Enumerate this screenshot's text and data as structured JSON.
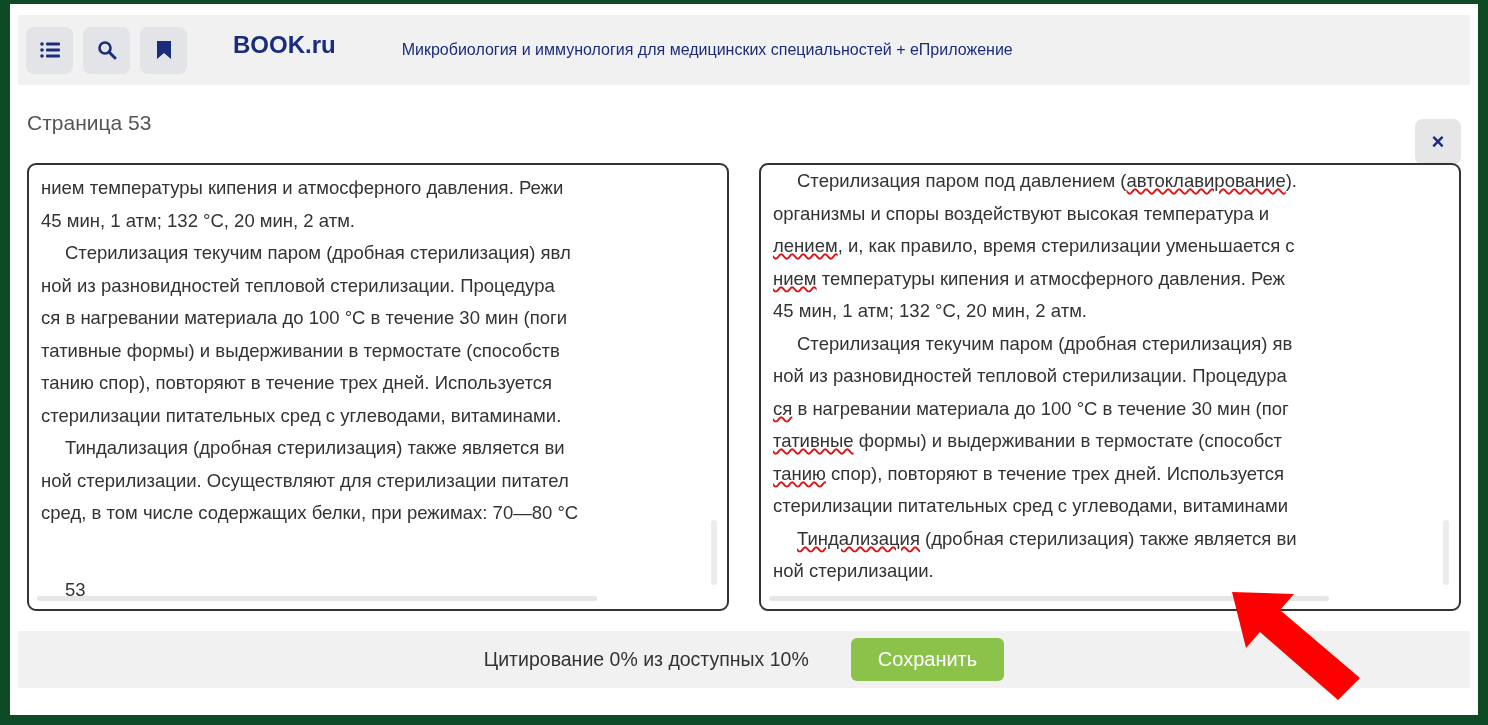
{
  "toolbar": {
    "buttons": [
      {
        "kind": "contents"
      },
      {
        "kind": "search"
      },
      {
        "kind": "bookmark"
      }
    ],
    "logo": "BOOK.ru",
    "book_title": "Микробиология и иммунология для медицинских специальностей + еПриложение"
  },
  "page_label": "Страница 53",
  "close_label": "×",
  "panels": [
    {
      "lines": [
        {
          "indent": false,
          "segments": [
            {
              "text": "нием температуры кипения и атмосферного давления. Режи",
              "misspelled": false
            }
          ]
        },
        {
          "indent": false,
          "segments": [
            {
              "text": "45 мин, 1 атм; 132 °C, 20 мин, 2 атм.",
              "misspelled": false
            }
          ]
        },
        {
          "indent": true,
          "segments": [
            {
              "text": "Стерилизация текучим паром (дробная стерилизация) явл",
              "misspelled": false
            }
          ]
        },
        {
          "indent": false,
          "segments": [
            {
              "text": "ной из разновидностей тепловой стерилизации. Процедура",
              "misspelled": false
            }
          ]
        },
        {
          "indent": false,
          "segments": [
            {
              "text": "ся в нагревании материала до 100 °C в течение 30 мин (поги",
              "misspelled": false
            }
          ]
        },
        {
          "indent": false,
          "segments": [
            {
              "text": "тативные формы) и выдерживании в термостате (способств",
              "misspelled": false
            }
          ]
        },
        {
          "indent": false,
          "segments": [
            {
              "text": "танию спор), повторяют в течение трех дней. Используется",
              "misspelled": false
            }
          ]
        },
        {
          "indent": false,
          "segments": [
            {
              "text": "стерилизации питательных сред с углеводами, витаминами.",
              "misspelled": false
            }
          ]
        },
        {
          "indent": true,
          "segments": [
            {
              "text": "Тиндализация (дробная стерилизация) также является ви",
              "misspelled": false
            }
          ]
        },
        {
          "indent": false,
          "segments": [
            {
              "text": "ной стерилизации. Осуществляют для стерилизации питател",
              "misspelled": false
            }
          ]
        },
        {
          "indent": false,
          "segments": [
            {
              "text": "сред, в том числе содержащих белки, при режимах: 70—80 °C",
              "misspelled": false
            }
          ]
        }
      ],
      "page_number": "53"
    },
    {
      "lines": [
        {
          "indent": true,
          "segments": [
            {
              "text": "Стерилизация паром под давлением (",
              "misspelled": false
            },
            {
              "text": "автоклавирование",
              "misspelled": true
            },
            {
              "text": ").",
              "misspelled": false
            }
          ]
        },
        {
          "indent": false,
          "segments": [
            {
              "text": "организмы и споры воздействуют высокая температура и",
              "misspelled": false
            }
          ]
        },
        {
          "indent": false,
          "segments": [
            {
              "text": "лением",
              "misspelled": true
            },
            {
              "text": ", и, как правило, время стерилизации уменьшается с",
              "misspelled": false
            }
          ]
        },
        {
          "indent": false,
          "segments": [
            {
              "text": "нием",
              "misspelled": true
            },
            {
              "text": " температуры кипения и атмосферного давления. Реж",
              "misspelled": false
            }
          ]
        },
        {
          "indent": false,
          "segments": [
            {
              "text": "45 мин, 1 атм; 132 °C, 20 мин, 2 атм.",
              "misspelled": false
            }
          ]
        },
        {
          "indent": true,
          "segments": [
            {
              "text": "Стерилизация текучим паром (дробная стерилизация) яв",
              "misspelled": false
            }
          ]
        },
        {
          "indent": false,
          "segments": [
            {
              "text": "ной из разновидностей тепловой стерилизации. Процедура",
              "misspelled": false
            }
          ]
        },
        {
          "indent": false,
          "segments": [
            {
              "text": "ся",
              "misspelled": true
            },
            {
              "text": " в нагревании материала до 100 °C в течение 30 мин (пог",
              "misspelled": false
            }
          ]
        },
        {
          "indent": false,
          "segments": [
            {
              "text": "тативные",
              "misspelled": true
            },
            {
              "text": " формы) и выдерживании в термостате (способст",
              "misspelled": false
            }
          ]
        },
        {
          "indent": false,
          "segments": [
            {
              "text": "танию",
              "misspelled": true
            },
            {
              "text": " спор), повторяют в течение трех дней. Используется",
              "misspelled": false
            }
          ]
        },
        {
          "indent": false,
          "segments": [
            {
              "text": "стерилизации питательных сред с углеводами, витаминами",
              "misspelled": false
            }
          ]
        },
        {
          "indent": true,
          "segments": [
            {
              "text": "Тиндализация",
              "misspelled": true
            },
            {
              "text": " (дробная стерилизация) также является ви",
              "misspelled": false
            }
          ]
        },
        {
          "indent": false,
          "segments": [
            {
              "text": "ной стерилизации.",
              "misspelled": false
            }
          ]
        }
      ]
    }
  ],
  "footer": {
    "citation": "Цитирование 0% из доступных 10%",
    "save_button": "Сохранить"
  }
}
